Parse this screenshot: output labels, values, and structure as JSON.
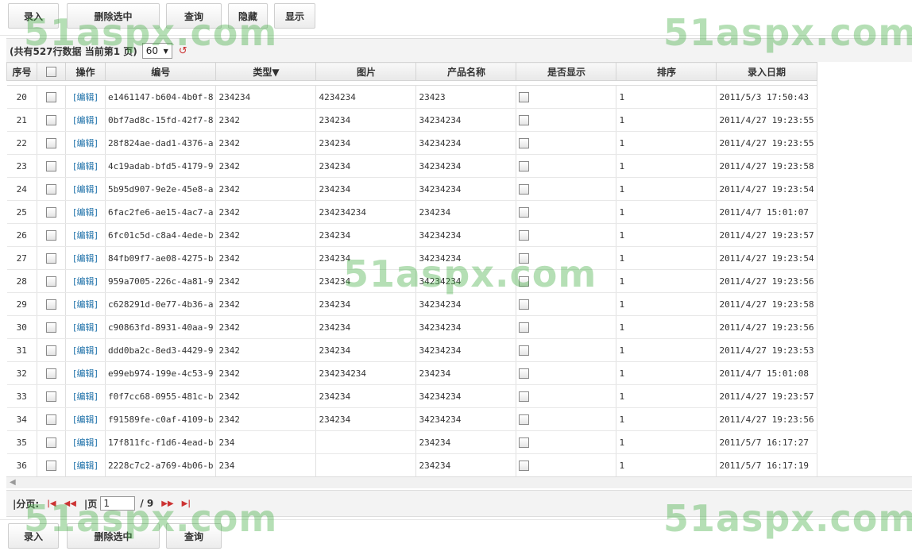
{
  "toolbar_top": {
    "add": "录入",
    "delete": "删除选中",
    "query": "查询",
    "hide": "隐藏",
    "show": "显示"
  },
  "toolbar_bottom": {
    "add": "录入",
    "delete": "删除选中",
    "query": "查询"
  },
  "info": {
    "text": "(共有527行数据 当前第1 页)",
    "page_size": "60",
    "refresh_icon": "refresh-icon"
  },
  "columns": [
    "序号",
    "",
    "操作",
    "编号",
    "类型▼",
    "图片",
    "产品名称",
    "是否显示",
    "排序",
    "录入日期"
  ],
  "edit_label": "[编辑]",
  "rows": [
    {
      "no": "20",
      "id": "e1461147-b604-4b0f-8",
      "type": "234234",
      "img": "4234234",
      "name": "23423",
      "sort": "1",
      "date": "2011/5/3 17:50:43"
    },
    {
      "no": "21",
      "id": "0bf7ad8c-15fd-42f7-8",
      "type": "2342",
      "img": "234234",
      "name": "34234234",
      "sort": "1",
      "date": "2011/4/27 19:23:55"
    },
    {
      "no": "22",
      "id": "28f824ae-dad1-4376-a",
      "type": "2342",
      "img": "234234",
      "name": "34234234",
      "sort": "1",
      "date": "2011/4/27 19:23:55"
    },
    {
      "no": "23",
      "id": "4c19adab-bfd5-4179-9",
      "type": "2342",
      "img": "234234",
      "name": "34234234",
      "sort": "1",
      "date": "2011/4/27 19:23:58"
    },
    {
      "no": "24",
      "id": "5b95d907-9e2e-45e8-a",
      "type": "2342",
      "img": "234234",
      "name": "34234234",
      "sort": "1",
      "date": "2011/4/27 19:23:54"
    },
    {
      "no": "25",
      "id": "6fac2fe6-ae15-4ac7-a",
      "type": "2342",
      "img": "234234234",
      "name": "234234",
      "sort": "1",
      "date": "2011/4/7 15:01:07"
    },
    {
      "no": "26",
      "id": "6fc01c5d-c8a4-4ede-b",
      "type": "2342",
      "img": "234234",
      "name": "34234234",
      "sort": "1",
      "date": "2011/4/27 19:23:57"
    },
    {
      "no": "27",
      "id": "84fb09f7-ae08-4275-b",
      "type": "2342",
      "img": "234234",
      "name": "34234234",
      "sort": "1",
      "date": "2011/4/27 19:23:54"
    },
    {
      "no": "28",
      "id": "959a7005-226c-4a81-9",
      "type": "2342",
      "img": "234234",
      "name": "34234234",
      "sort": "1",
      "date": "2011/4/27 19:23:56"
    },
    {
      "no": "29",
      "id": "c628291d-0e77-4b36-a",
      "type": "2342",
      "img": "234234",
      "name": "34234234",
      "sort": "1",
      "date": "2011/4/27 19:23:58"
    },
    {
      "no": "30",
      "id": "c90863fd-8931-40aa-9",
      "type": "2342",
      "img": "234234",
      "name": "34234234",
      "sort": "1",
      "date": "2011/4/27 19:23:56"
    },
    {
      "no": "31",
      "id": "ddd0ba2c-8ed3-4429-9",
      "type": "2342",
      "img": "234234",
      "name": "34234234",
      "sort": "1",
      "date": "2011/4/27 19:23:53"
    },
    {
      "no": "32",
      "id": "e99eb974-199e-4c53-9",
      "type": "2342",
      "img": "234234234",
      "name": "234234",
      "sort": "1",
      "date": "2011/4/7 15:01:08"
    },
    {
      "no": "33",
      "id": "f0f7cc68-0955-481c-b",
      "type": "2342",
      "img": "234234",
      "name": "34234234",
      "sort": "1",
      "date": "2011/4/27 19:23:57"
    },
    {
      "no": "34",
      "id": "f91589fe-c0af-4109-b",
      "type": "2342",
      "img": "234234",
      "name": "34234234",
      "sort": "1",
      "date": "2011/4/27 19:23:56"
    },
    {
      "no": "35",
      "id": "17f811fc-f1d6-4ead-b",
      "type": "234",
      "img": "",
      "name": "234234",
      "sort": "1",
      "date": "2011/5/7 16:17:27"
    },
    {
      "no": "36",
      "id": "2228c7c2-a769-4b06-b",
      "type": "234",
      "img": "",
      "name": "234234",
      "sort": "1",
      "date": "2011/5/7 16:17:19"
    }
  ],
  "pager": {
    "label": "|分页:",
    "page_label": "|页",
    "current": "1",
    "total": "/ 9",
    "first_icon": "first-page-icon",
    "prev_icon": "prev-page-icon",
    "next_icon": "next-page-icon",
    "last_icon": "last-page-icon"
  },
  "watermark": "51aspx.com"
}
